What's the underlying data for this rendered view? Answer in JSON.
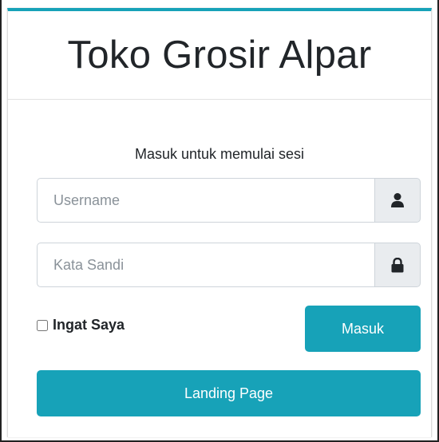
{
  "header": {
    "title": "Toko Grosir Alpar"
  },
  "login": {
    "message": "Masuk untuk memulai sesi",
    "username_placeholder": "Username",
    "username_value": "",
    "username_icon": "user-icon",
    "password_placeholder": "Kata Sandi",
    "password_value": "",
    "password_icon": "lock-icon",
    "remember_label": "Ingat Saya",
    "remember_checked": false,
    "submit_label": "Masuk",
    "landing_label": "Landing Page"
  },
  "colors": {
    "accent": "#17a2b8",
    "addon_bg": "#e9ecef",
    "text": "#212529"
  }
}
